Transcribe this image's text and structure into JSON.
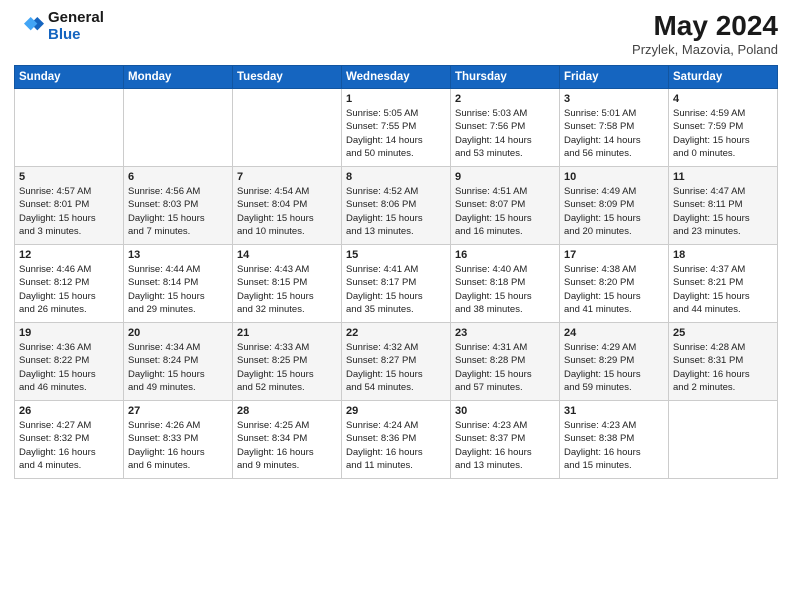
{
  "header": {
    "logo_general": "General",
    "logo_blue": "Blue",
    "title": "May 2024",
    "subtitle": "Przylek, Mazovia, Poland"
  },
  "days_of_week": [
    "Sunday",
    "Monday",
    "Tuesday",
    "Wednesday",
    "Thursday",
    "Friday",
    "Saturday"
  ],
  "weeks": [
    {
      "days": [
        {
          "num": "",
          "empty": true,
          "lines": []
        },
        {
          "num": "",
          "empty": true,
          "lines": []
        },
        {
          "num": "",
          "empty": true,
          "lines": []
        },
        {
          "num": "1",
          "empty": false,
          "lines": [
            "Sunrise: 5:05 AM",
            "Sunset: 7:55 PM",
            "Daylight: 14 hours",
            "and 50 minutes."
          ]
        },
        {
          "num": "2",
          "empty": false,
          "lines": [
            "Sunrise: 5:03 AM",
            "Sunset: 7:56 PM",
            "Daylight: 14 hours",
            "and 53 minutes."
          ]
        },
        {
          "num": "3",
          "empty": false,
          "lines": [
            "Sunrise: 5:01 AM",
            "Sunset: 7:58 PM",
            "Daylight: 14 hours",
            "and 56 minutes."
          ]
        },
        {
          "num": "4",
          "empty": false,
          "lines": [
            "Sunrise: 4:59 AM",
            "Sunset: 7:59 PM",
            "Daylight: 15 hours",
            "and 0 minutes."
          ]
        }
      ]
    },
    {
      "days": [
        {
          "num": "5",
          "empty": false,
          "lines": [
            "Sunrise: 4:57 AM",
            "Sunset: 8:01 PM",
            "Daylight: 15 hours",
            "and 3 minutes."
          ]
        },
        {
          "num": "6",
          "empty": false,
          "lines": [
            "Sunrise: 4:56 AM",
            "Sunset: 8:03 PM",
            "Daylight: 15 hours",
            "and 7 minutes."
          ]
        },
        {
          "num": "7",
          "empty": false,
          "lines": [
            "Sunrise: 4:54 AM",
            "Sunset: 8:04 PM",
            "Daylight: 15 hours",
            "and 10 minutes."
          ]
        },
        {
          "num": "8",
          "empty": false,
          "lines": [
            "Sunrise: 4:52 AM",
            "Sunset: 8:06 PM",
            "Daylight: 15 hours",
            "and 13 minutes."
          ]
        },
        {
          "num": "9",
          "empty": false,
          "lines": [
            "Sunrise: 4:51 AM",
            "Sunset: 8:07 PM",
            "Daylight: 15 hours",
            "and 16 minutes."
          ]
        },
        {
          "num": "10",
          "empty": false,
          "lines": [
            "Sunrise: 4:49 AM",
            "Sunset: 8:09 PM",
            "Daylight: 15 hours",
            "and 20 minutes."
          ]
        },
        {
          "num": "11",
          "empty": false,
          "lines": [
            "Sunrise: 4:47 AM",
            "Sunset: 8:11 PM",
            "Daylight: 15 hours",
            "and 23 minutes."
          ]
        }
      ]
    },
    {
      "days": [
        {
          "num": "12",
          "empty": false,
          "lines": [
            "Sunrise: 4:46 AM",
            "Sunset: 8:12 PM",
            "Daylight: 15 hours",
            "and 26 minutes."
          ]
        },
        {
          "num": "13",
          "empty": false,
          "lines": [
            "Sunrise: 4:44 AM",
            "Sunset: 8:14 PM",
            "Daylight: 15 hours",
            "and 29 minutes."
          ]
        },
        {
          "num": "14",
          "empty": false,
          "lines": [
            "Sunrise: 4:43 AM",
            "Sunset: 8:15 PM",
            "Daylight: 15 hours",
            "and 32 minutes."
          ]
        },
        {
          "num": "15",
          "empty": false,
          "lines": [
            "Sunrise: 4:41 AM",
            "Sunset: 8:17 PM",
            "Daylight: 15 hours",
            "and 35 minutes."
          ]
        },
        {
          "num": "16",
          "empty": false,
          "lines": [
            "Sunrise: 4:40 AM",
            "Sunset: 8:18 PM",
            "Daylight: 15 hours",
            "and 38 minutes."
          ]
        },
        {
          "num": "17",
          "empty": false,
          "lines": [
            "Sunrise: 4:38 AM",
            "Sunset: 8:20 PM",
            "Daylight: 15 hours",
            "and 41 minutes."
          ]
        },
        {
          "num": "18",
          "empty": false,
          "lines": [
            "Sunrise: 4:37 AM",
            "Sunset: 8:21 PM",
            "Daylight: 15 hours",
            "and 44 minutes."
          ]
        }
      ]
    },
    {
      "days": [
        {
          "num": "19",
          "empty": false,
          "lines": [
            "Sunrise: 4:36 AM",
            "Sunset: 8:22 PM",
            "Daylight: 15 hours",
            "and 46 minutes."
          ]
        },
        {
          "num": "20",
          "empty": false,
          "lines": [
            "Sunrise: 4:34 AM",
            "Sunset: 8:24 PM",
            "Daylight: 15 hours",
            "and 49 minutes."
          ]
        },
        {
          "num": "21",
          "empty": false,
          "lines": [
            "Sunrise: 4:33 AM",
            "Sunset: 8:25 PM",
            "Daylight: 15 hours",
            "and 52 minutes."
          ]
        },
        {
          "num": "22",
          "empty": false,
          "lines": [
            "Sunrise: 4:32 AM",
            "Sunset: 8:27 PM",
            "Daylight: 15 hours",
            "and 54 minutes."
          ]
        },
        {
          "num": "23",
          "empty": false,
          "lines": [
            "Sunrise: 4:31 AM",
            "Sunset: 8:28 PM",
            "Daylight: 15 hours",
            "and 57 minutes."
          ]
        },
        {
          "num": "24",
          "empty": false,
          "lines": [
            "Sunrise: 4:29 AM",
            "Sunset: 8:29 PM",
            "Daylight: 15 hours",
            "and 59 minutes."
          ]
        },
        {
          "num": "25",
          "empty": false,
          "lines": [
            "Sunrise: 4:28 AM",
            "Sunset: 8:31 PM",
            "Daylight: 16 hours",
            "and 2 minutes."
          ]
        }
      ]
    },
    {
      "days": [
        {
          "num": "26",
          "empty": false,
          "lines": [
            "Sunrise: 4:27 AM",
            "Sunset: 8:32 PM",
            "Daylight: 16 hours",
            "and 4 minutes."
          ]
        },
        {
          "num": "27",
          "empty": false,
          "lines": [
            "Sunrise: 4:26 AM",
            "Sunset: 8:33 PM",
            "Daylight: 16 hours",
            "and 6 minutes."
          ]
        },
        {
          "num": "28",
          "empty": false,
          "lines": [
            "Sunrise: 4:25 AM",
            "Sunset: 8:34 PM",
            "Daylight: 16 hours",
            "and 9 minutes."
          ]
        },
        {
          "num": "29",
          "empty": false,
          "lines": [
            "Sunrise: 4:24 AM",
            "Sunset: 8:36 PM",
            "Daylight: 16 hours",
            "and 11 minutes."
          ]
        },
        {
          "num": "30",
          "empty": false,
          "lines": [
            "Sunrise: 4:23 AM",
            "Sunset: 8:37 PM",
            "Daylight: 16 hours",
            "and 13 minutes."
          ]
        },
        {
          "num": "31",
          "empty": false,
          "lines": [
            "Sunrise: 4:23 AM",
            "Sunset: 8:38 PM",
            "Daylight: 16 hours",
            "and 15 minutes."
          ]
        },
        {
          "num": "",
          "empty": true,
          "lines": []
        }
      ]
    }
  ]
}
